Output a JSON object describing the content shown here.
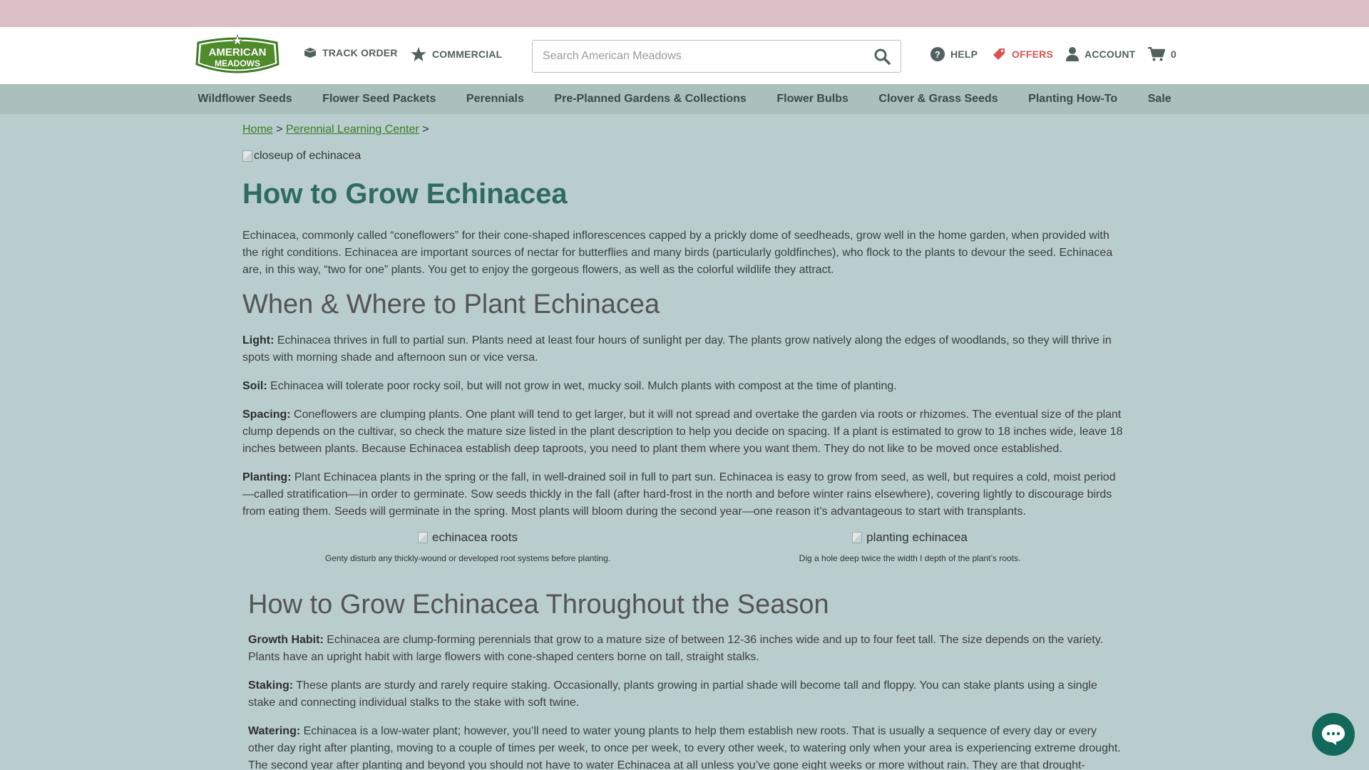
{
  "header": {
    "logo_text_top": "AMERICAN",
    "logo_text_bottom": "MEADOWS",
    "track_order": "TRACK ORDER",
    "commercial": "COMMERCIAL",
    "search_placeholder": "Search American Meadows",
    "help": "HELP",
    "offers": "OFFERS",
    "account": "ACCOUNT",
    "cart_count": "0"
  },
  "nav": {
    "items": [
      {
        "label": "Wildflower Seeds"
      },
      {
        "label": "Flower Seed Packets"
      },
      {
        "label": "Perennials"
      },
      {
        "label": "Pre-Planned Gardens & Collections"
      },
      {
        "label": "Flower Bulbs"
      },
      {
        "label": "Clover & Grass Seeds"
      },
      {
        "label": "Planting How-To"
      },
      {
        "label": "Sale"
      }
    ]
  },
  "breadcrumb": {
    "home": "Home",
    "sep": ">",
    "learning_center": "Perennial Learning Center"
  },
  "hero_alt": "closeup of echinacea",
  "article": {
    "title": "How to Grow Echinacea",
    "intro_line1": "Echinacea, commonly called “coneflowers” for their cone-shaped inflorescences capped by a prickly dome of seedheads, grow well in the home garden, when provided with",
    "intro_line2": "the right conditions. Echinacea are important sources of nectar for butterflies and many birds (particularly goldfinches), who flock to the plants to devour the seed. Echinacea",
    "intro_line3": "are, in this way, “two for one” plants. You get to enjoy the gorgeous flowers, as well as the colorful wildlife they attract.",
    "section1_title": "When & Where to Plant Echinacea",
    "light_label": "Light:",
    "light_line1": " Echinacea thrives in full to partial sun. Plants need at least four hours of sunlight per day. The plants grow natively along the edges of woodlands, so they will thrive in",
    "light_line2": "spots with morning shade and afternoon sun or vice versa.",
    "soil_label": "Soil:",
    "soil_line1": " Echinacea will tolerate poor rocky soil, but will not grow in wet, mucky soil. Mulch plants with compost at the time of planting.",
    "spacing_label": "Spacing:",
    "spacing_line1": " Coneflowers are clumping plants. One plant will tend to get larger, but it will not spread and overtake the garden via roots or rhizomes. The eventual size of the plant",
    "spacing_line2": "clump depends on the cultivar, so check the mature size listed in the plant description to help you decide on spacing. If a plant is estimated to grow to 18 inches wide, leave 18",
    "spacing_line3": "inches between plants. Because Echinacea establish deep taproots, you need to plant them where you want them. They do not like to be moved once established.",
    "planting_label": "Planting:",
    "planting_line1": " Plant Echinacea plants in the spring or the fall, in well-drained soil in full to part sun. Echinacea is easy to grow from seed, as well, but requires a cold, moist period",
    "planting_line2": "—called stratification—in order to germinate. Sow seeds thickly in the fall (after hard-frost in the north and before winter rains elsewhere), covering lightly to discourage birds",
    "planting_line3": "from eating them. Seeds will germinate in the spring. Most plants will bloom during the second year—one reason it’s advantageous to start with transplants.",
    "fig1_alt": "echinacea roots",
    "fig1_caption": "Genty disturb any thickly-wound or developed root systems before planting.",
    "fig2_alt": "planting echinacea",
    "fig2_caption": "Dig a hole deep twice the width I depth of the plant’s roots.",
    "section2_title": "How to Grow Echinacea Throughout the Season",
    "growth_label": "Growth Habit:",
    "growth_line1": " Echinacea are clump-forming perennials that grow to a mature size of between 12-36 inches wide and up to four feet tall. The size depends on the variety.",
    "growth_line2": "Plants have an upright habit with large flowers with cone-shaped centers borne on tall, straight stalks.",
    "staking_label": "Staking:",
    "staking_line1": " These plants are sturdy and rarely require staking. Occasionally, plants growing in partial shade will become tall and floppy. You can stake plants using a single",
    "staking_line2": "stake and connecting individual stalks to the stake with soft twine.",
    "watering_label": "Watering:",
    "watering_line1": " Echinacea is a low-water plant; however, you’ll need to water young plants to help them establish new roots. That is usually a sequence of every day or every",
    "watering_line2": "other day right after planting, moving to a couple of times per week, to once per week, to every other week, to watering only when your area is experiencing extreme drought.",
    "watering_line3": "The second year after planting and beyond you should not have to water Echinacea at all unless you’ve gone eight weeks or more without rain. They are that drought-"
  },
  "colors": {
    "brand_green": "#3c7a22",
    "title_teal": "#2f6b62",
    "offers_red": "#d9534f",
    "chat_teal": "#12695b"
  }
}
